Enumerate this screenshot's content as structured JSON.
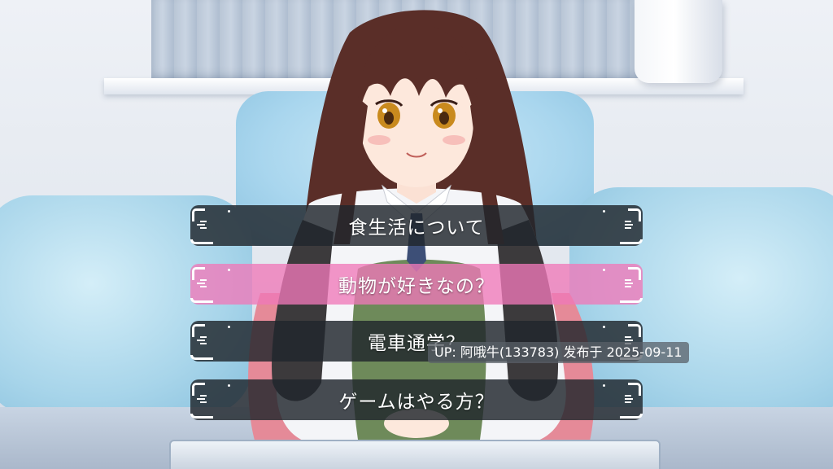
{
  "choices": [
    {
      "label": "食生活について",
      "selected": false
    },
    {
      "label": "動物が好きなの？",
      "selected": true
    },
    {
      "label": "電車通学？",
      "selected": false
    },
    {
      "label": "ゲームはやる方？",
      "selected": false
    }
  ],
  "watermark": {
    "text": "UP: 阿哦牛(133783) 发布于 2025-09-11"
  },
  "colors": {
    "choice_bar": "#20262C",
    "choice_selected": "#F078B9",
    "choice_text": "#FFFFFF",
    "hair": "#5a2e28",
    "eyes": "#c98a1e"
  }
}
